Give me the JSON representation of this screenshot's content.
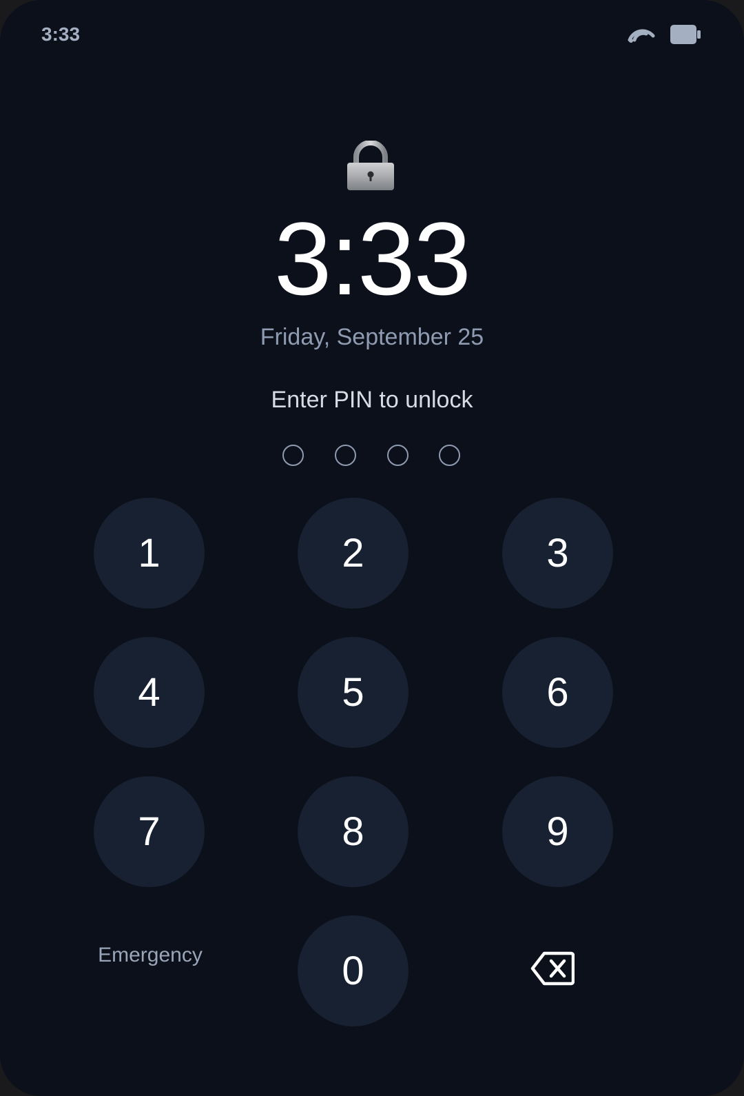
{
  "status_bar": {
    "time": "3:33",
    "icons": [
      "signal-icon",
      "battery-icon"
    ]
  },
  "lock_screen": {
    "lock_icon": "padlock-icon",
    "clock": "3:33",
    "date": "Friday, September 25",
    "prompt": "Enter PIN to unlock",
    "pin_length": 4,
    "pin_entered": 0
  },
  "keypad": {
    "keys": [
      "1",
      "2",
      "3",
      "4",
      "5",
      "6",
      "7",
      "8",
      "9",
      "0"
    ],
    "emergency_label": "Emergency",
    "backspace_icon": "backspace-icon"
  },
  "colors": {
    "background": "#0b101b",
    "key_fill": "#172131",
    "primary_text": "#ffffff",
    "secondary_text": "#8f9bb0"
  }
}
